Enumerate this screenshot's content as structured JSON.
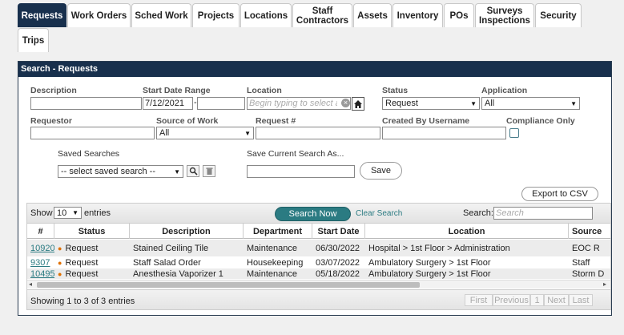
{
  "tabs": [
    {
      "label": "Requests",
      "active": true
    },
    {
      "label": "Work Orders"
    },
    {
      "label": "Sched Work"
    },
    {
      "label": "Projects"
    },
    {
      "label": "Locations"
    },
    {
      "label": "Staff\nContractors"
    },
    {
      "label": "Assets"
    },
    {
      "label": "Inventory"
    },
    {
      "label": "POs"
    },
    {
      "label": "Surveys\nInspections"
    },
    {
      "label": "Security"
    },
    {
      "label": "Trips"
    }
  ],
  "panel": {
    "title": "Search - Requests"
  },
  "form": {
    "description_label": "Description",
    "description_value": "",
    "start_date_label": "Start Date Range",
    "start_date_from": "7/12/2021",
    "start_date_sep": "-",
    "start_date_to": "",
    "location_label": "Location",
    "location_placeholder": "Begin typing to select a lo",
    "status_label": "Status",
    "status_value": "Request",
    "application_label": "Application",
    "application_value": "All",
    "requestor_label": "Requestor",
    "source_label": "Source of Work",
    "source_value": "All",
    "request_no_label": "Request #",
    "created_by_label": "Created By Username",
    "compliance_label": "Compliance Only",
    "saved_searches_label": "Saved Searches",
    "saved_search_value": "-- select saved search --",
    "save_as_label": "Save Current Search As...",
    "save_button": "Save",
    "export_button": "Export to CSV"
  },
  "grid": {
    "show_label": "Show",
    "entries_value": "10",
    "entries_label": "entries",
    "search_now": "Search Now",
    "clear_search": "Clear Search",
    "search_label": "Search:",
    "search_placeholder": "Search",
    "columns": [
      "#",
      "Status",
      "Description",
      "Department",
      "Start Date",
      "Location",
      "Source"
    ],
    "rows": [
      {
        "id": "10920",
        "status": "Request",
        "description": "Stained Ceiling Tile",
        "department": "Maintenance",
        "start_date": "06/30/2022",
        "location": "Hospital > 1st Floor > Administration",
        "source": "EOC R"
      },
      {
        "id": "9307",
        "status": "Request",
        "description": "Staff Salad Order",
        "department": "Housekeeping",
        "start_date": "03/07/2022",
        "location": "Ambulatory Surgery > 1st Floor",
        "source": "Staff"
      },
      {
        "id": "10495",
        "status": "Request",
        "description": "Anesthesia Vaporizer 1",
        "department": "Maintenance",
        "start_date": "05/18/2022",
        "location": "Ambulatory Surgery > 1st Floor",
        "source": "Storm D"
      }
    ],
    "summary": "Showing 1 to 3 of 3 entries",
    "pager": {
      "first": "First",
      "previous": "Previous",
      "page": "1",
      "next": "Next",
      "last": "Last"
    }
  },
  "colors": {
    "header_bg": "#18304d",
    "accent": "#2b7b82",
    "status_dot": "#e07000"
  }
}
